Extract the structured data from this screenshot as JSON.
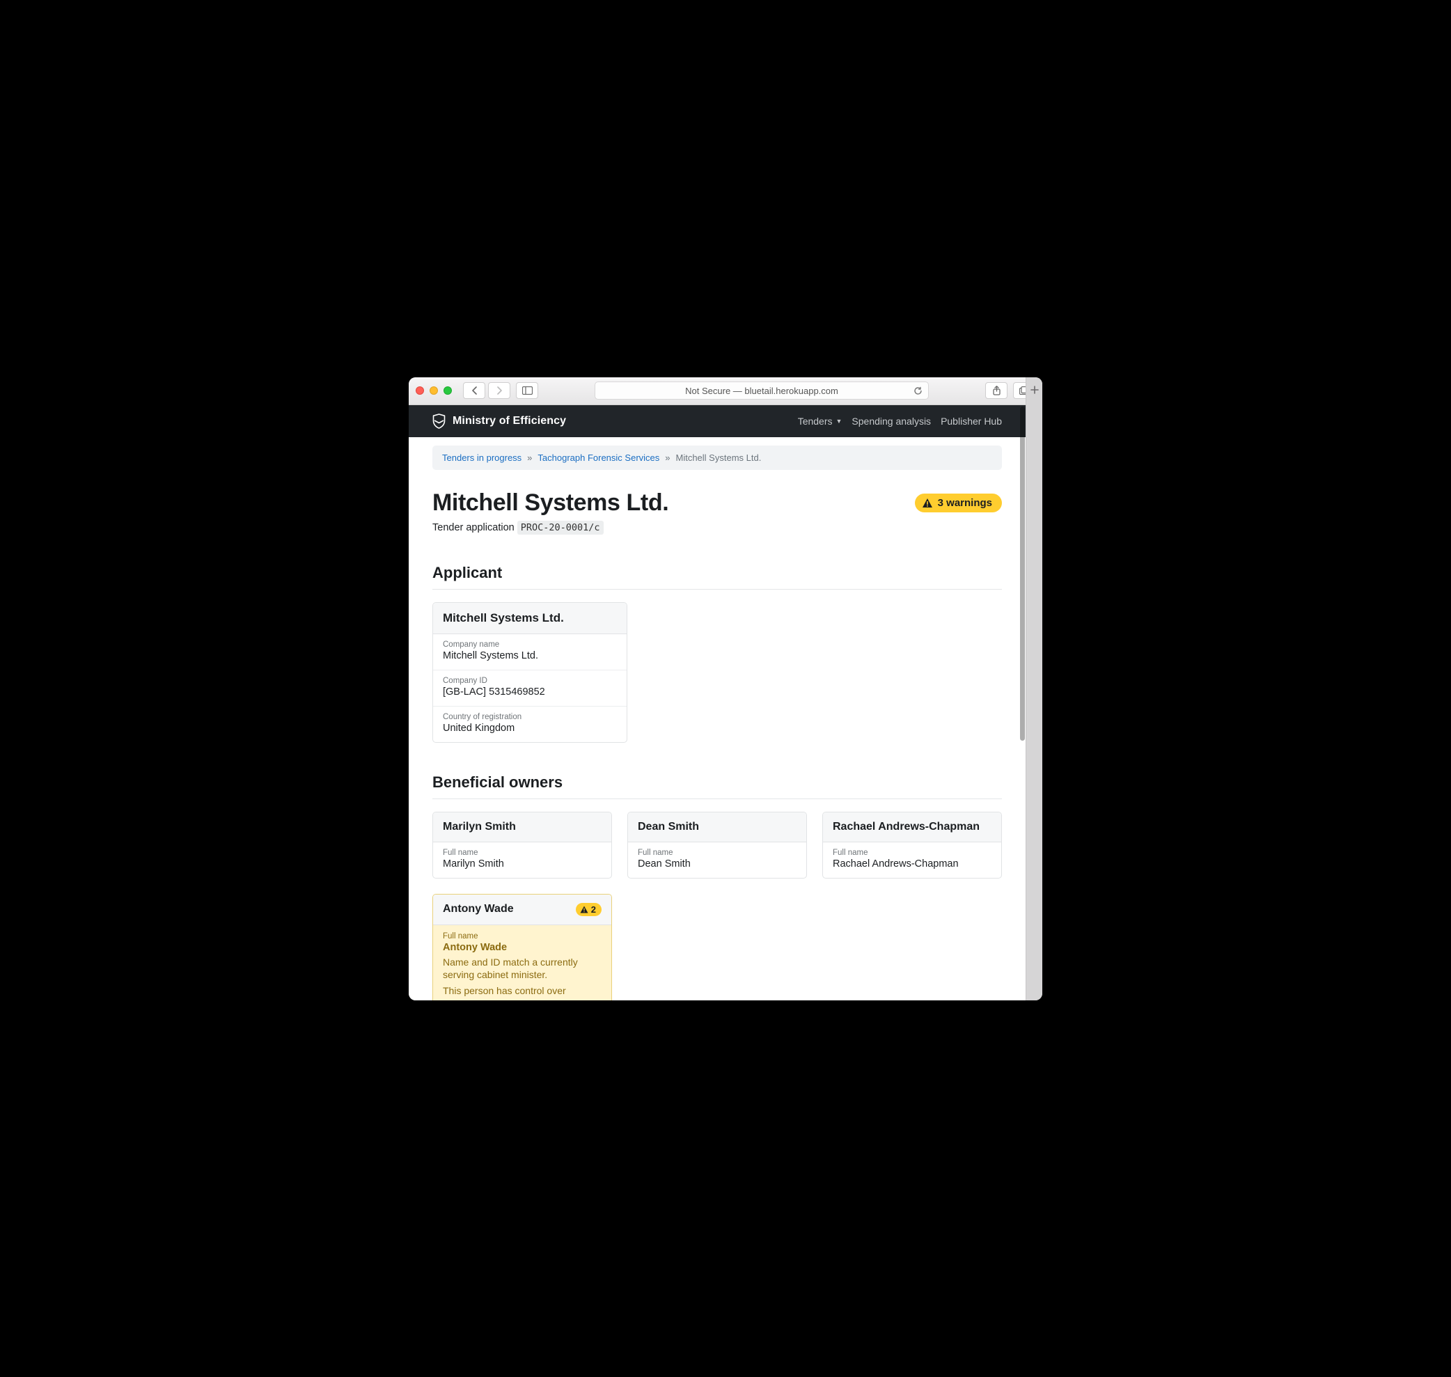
{
  "browser": {
    "address_prefix": "Not Secure — ",
    "address_host": "bluetail.herokuapp.com"
  },
  "appHeader": {
    "brand": "Ministry of Efficiency",
    "nav": {
      "tenders": "Tenders",
      "spending": "Spending analysis",
      "publisher": "Publisher Hub"
    }
  },
  "breadcrumb": {
    "a": "Tenders in progress",
    "b": "Tachograph Forensic Services",
    "current": "Mitchell Systems Ltd."
  },
  "title": "Mitchell Systems Ltd.",
  "warnings": {
    "label": "3 warnings"
  },
  "subtitle": {
    "prefix": "Tender application ",
    "code": "PROC-20-0001/c"
  },
  "sections": {
    "applicant": "Applicant",
    "owners": "Beneficial owners"
  },
  "applicant": {
    "header": "Mitchell Systems Ltd.",
    "rows": {
      "companyName": {
        "label": "Company name",
        "value": "Mitchell Systems Ltd."
      },
      "companyId": {
        "label": "Company ID",
        "value": "[GB-LAC] 5315469852"
      },
      "country": {
        "label": "Country of registration",
        "value": "United Kingdom"
      }
    }
  },
  "owners": [
    {
      "name": "Marilyn Smith",
      "fullnameLabel": "Full name",
      "fullname": "Marilyn Smith"
    },
    {
      "name": "Dean Smith",
      "fullnameLabel": "Full name",
      "fullname": "Dean Smith"
    },
    {
      "name": "Rachael Andrews-Chapman",
      "fullnameLabel": "Full name",
      "fullname": "Rachael Andrews-Chapman"
    }
  ],
  "flaggedOwner": {
    "name": "Antony Wade",
    "badgeCount": "2",
    "fullnameLabel": "Full name",
    "fullname": "Antony Wade",
    "msg1": "Name and ID match a currently serving cabinet minister.",
    "msg2": "This person has control over multiple applicants to this tender."
  }
}
